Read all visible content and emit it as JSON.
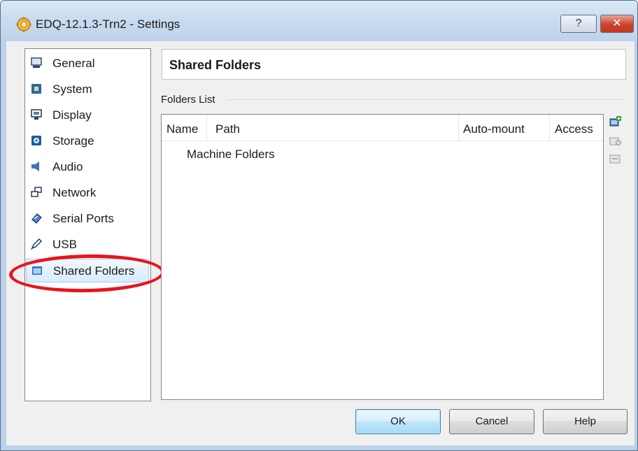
{
  "window": {
    "title": "EDQ-12.1.3-Trn2 - Settings",
    "help_label": "?",
    "close_label": "✕"
  },
  "sidebar": {
    "items": [
      {
        "label": "General",
        "icon": "monitor-icon"
      },
      {
        "label": "System",
        "icon": "chip-icon"
      },
      {
        "label": "Display",
        "icon": "display-icon"
      },
      {
        "label": "Storage",
        "icon": "storage-icon"
      },
      {
        "label": "Audio",
        "icon": "speaker-icon"
      },
      {
        "label": "Network",
        "icon": "network-icon"
      },
      {
        "label": "Serial Ports",
        "icon": "serial-port-icon"
      },
      {
        "label": "USB",
        "icon": "usb-icon"
      },
      {
        "label": "Shared Folders",
        "icon": "folder-icon",
        "selected": true
      }
    ]
  },
  "main": {
    "title": "Shared Folders",
    "folders_list_label": "Folders List",
    "columns": [
      "Name",
      "Path",
      "Auto-mount",
      "Access"
    ],
    "rows": [
      "Machine Folders"
    ],
    "tools": [
      "add-folder-icon",
      "edit-folder-icon",
      "remove-folder-icon"
    ]
  },
  "buttons": {
    "ok": "OK",
    "cancel": "Cancel",
    "help": "Help"
  },
  "colors": {
    "selection_bg": "#d9ebfb",
    "annotation_ellipse": "#e8141b",
    "default_button": "#bee6fd"
  }
}
